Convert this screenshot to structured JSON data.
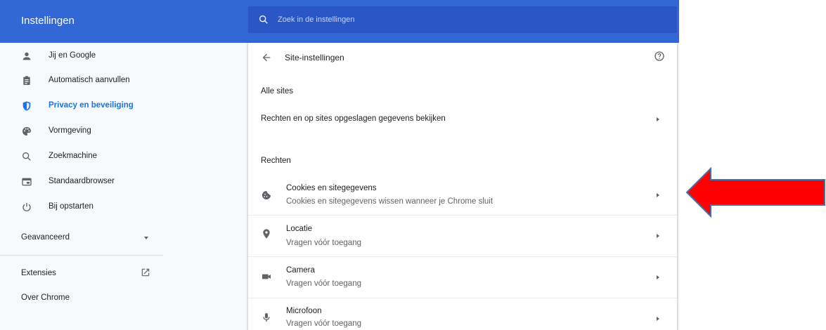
{
  "app": {
    "title": "Instellingen"
  },
  "search": {
    "placeholder": "Zoek in de instellingen"
  },
  "sidebar": {
    "items": [
      {
        "label": "Jij en Google",
        "icon": "person-icon"
      },
      {
        "label": "Automatisch aanvullen",
        "icon": "clipboard-icon"
      },
      {
        "label": "Privacy en beveiliging",
        "icon": "shield-icon",
        "active": true
      },
      {
        "label": "Vormgeving",
        "icon": "palette-icon"
      },
      {
        "label": "Zoekmachine",
        "icon": "search-icon"
      },
      {
        "label": "Standaardbrowser",
        "icon": "browser-icon"
      },
      {
        "label": "Bij opstarten",
        "icon": "power-icon"
      }
    ],
    "advanced": "Geavanceerd",
    "extensions": "Extensies",
    "about": "Over Chrome"
  },
  "page": {
    "title": "Site-instellingen",
    "all_sites_heading": "Alle sites",
    "all_sites_row": "Rechten en op sites opgeslagen gegevens bekijken",
    "permissions_heading": "Rechten",
    "permissions": [
      {
        "title": "Cookies en sitegegevens",
        "subtitle": "Cookies en sitegegevens wissen wanneer je Chrome sluit",
        "icon": "cookie-icon"
      },
      {
        "title": "Locatie",
        "subtitle": "Vragen vóór toegang",
        "icon": "location-icon"
      },
      {
        "title": "Camera",
        "subtitle": "Vragen vóór toegang",
        "icon": "camera-icon"
      },
      {
        "title": "Microfoon",
        "subtitle": "Vragen vóór toegang",
        "icon": "mic-icon"
      }
    ]
  },
  "colors": {
    "header_blue": "#3367d6",
    "search_blue": "#2a56c6",
    "active_blue": "#1a73e8",
    "annotation_red": "#ff0000",
    "annotation_outline": "#4a6fa5"
  }
}
